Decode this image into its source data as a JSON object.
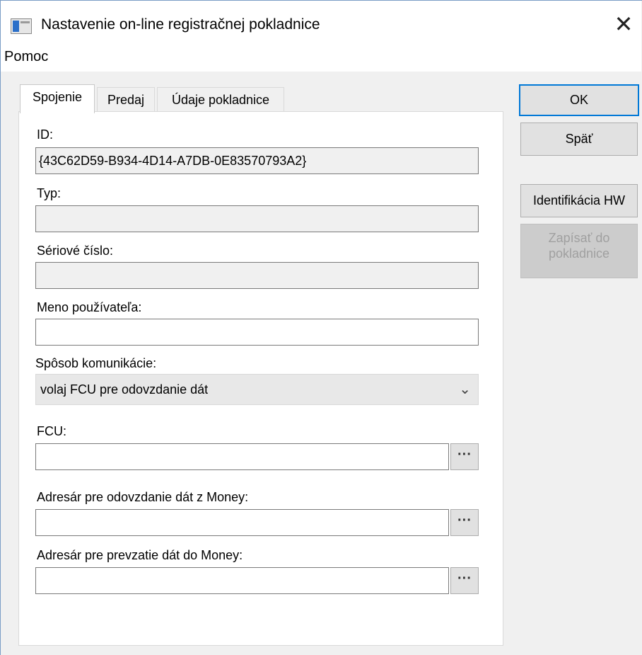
{
  "window": {
    "title": "Nastavenie on-line registračnej pokladnice",
    "close_glyph": "✕"
  },
  "menu": [
    "Pomoc"
  ],
  "tabs": [
    {
      "label": "Spojenie",
      "active": true
    },
    {
      "label": "Predaj",
      "active": false
    },
    {
      "label": "Údaje pokladnice",
      "active": false
    }
  ],
  "form": {
    "id_label": "ID:",
    "id_value": "{43C62D59-B934-4D14-A7DB-0E83570793A2}",
    "typ_label": "Typ:",
    "typ_value": "",
    "serial_label": "Sériové číslo:",
    "serial_value": "",
    "user_label": "Meno používateľa:",
    "user_value": "",
    "comm_label": "Spôsob komunikácie:",
    "comm_value": "volaj FCU pre odovzdanie dát",
    "fcu_label": "FCU:",
    "fcu_value": "",
    "export_dir_label": "Adresár pre odovzdanie dát z Money:",
    "export_dir_value": "",
    "import_dir_label": "Adresár pre prevzatie dát do Money:",
    "import_dir_value": "",
    "browse_glyph": "···"
  },
  "buttons": {
    "ok": "OK",
    "back": "Späť",
    "identify_hw": "Identifikácia HW",
    "write_line1": "Zapísať do",
    "write_line2": "pokladnice"
  },
  "icons": {
    "app": "app-window-icon",
    "close": "close-icon",
    "dropdown": "chevron-down-icon",
    "browse": "ellipsis-icon"
  }
}
